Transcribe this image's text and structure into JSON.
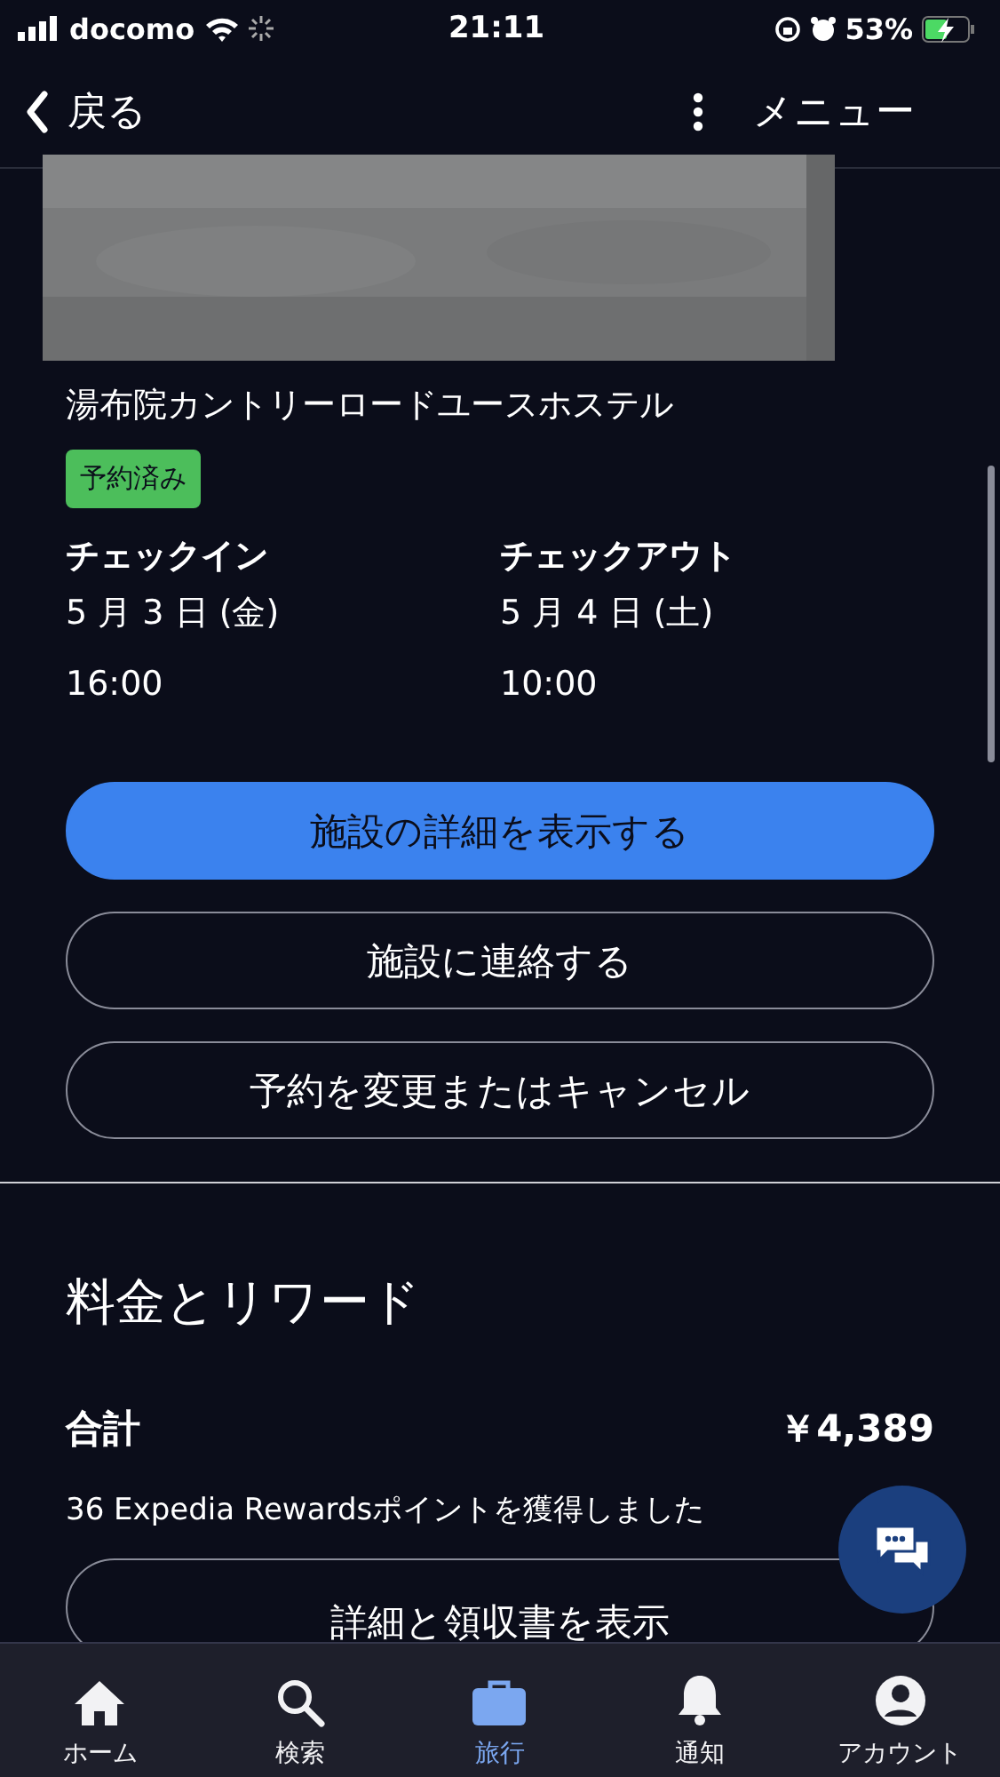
{
  "status_bar": {
    "carrier": "docomo",
    "time": "21:11",
    "battery": "53%"
  },
  "nav": {
    "back": "戻る",
    "menu": "メニュー"
  },
  "hotel": {
    "name": "湯布院カントリーロードユースホステル",
    "badge": "予約済み"
  },
  "stay": [
    {
      "label": "チェックイン",
      "date": "5 月 3 日 (金)",
      "time": "16:00"
    },
    {
      "label": "チェックアウト",
      "date": "5 月 4 日 (土)",
      "time": "10:00"
    }
  ],
  "actions": [
    {
      "label": "施設の詳細を表示する",
      "kind": "primary"
    },
    {
      "label": "施設に連絡する",
      "kind": "outline"
    },
    {
      "label": "予約を変更またはキャンセル",
      "kind": "outline"
    }
  ],
  "price": {
    "heading": "料金とリワード",
    "total_label": "合計",
    "total": "￥4,389",
    "rewards": "36 Expedia Rewardsポイントを獲得しました",
    "receipt_button": "詳細と領収書を表示"
  },
  "tabs": [
    {
      "label": "ホーム",
      "kind": "home",
      "selected": false
    },
    {
      "label": "検索",
      "kind": "search",
      "selected": false
    },
    {
      "label": "旅行",
      "kind": "trips",
      "selected": true
    },
    {
      "label": "通知",
      "kind": "bell",
      "selected": false
    },
    {
      "label": "アカウント",
      "kind": "account",
      "selected": false
    }
  ]
}
